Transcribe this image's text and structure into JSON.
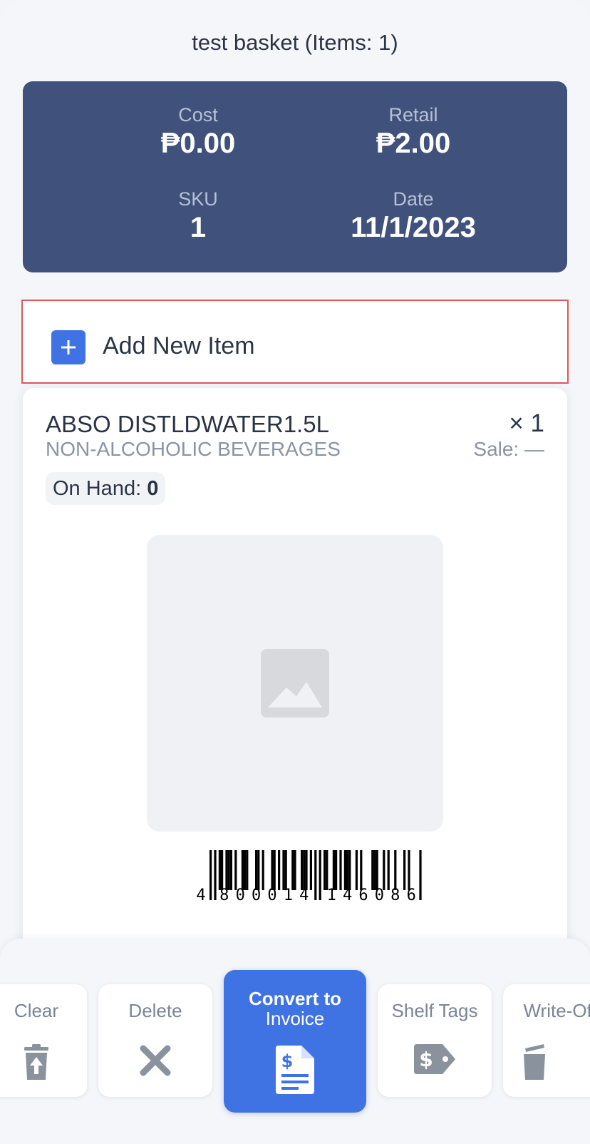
{
  "header": {
    "title": "test basket (Items: 1)"
  },
  "summary": {
    "cost_label": "Cost",
    "cost_value": "₱0.00",
    "retail_label": "Retail",
    "retail_value": "₱2.00",
    "sku_label": "SKU",
    "sku_value": "1",
    "date_label": "Date",
    "date_value": "11/1/2023"
  },
  "add_item": {
    "label": "Add New Item",
    "icon": "plus-icon"
  },
  "item": {
    "name": "ABSO DISTLDWATER1.5L",
    "category": "NON-ALCOHOLIC BEVERAGES",
    "quantity": "× 1",
    "sale": "Sale: —",
    "on_hand_label": "On Hand:",
    "on_hand_value": "0",
    "image_icon": "image-placeholder-icon",
    "barcode": "4800014146086"
  },
  "actions": {
    "clear": "Clear",
    "delete": "Delete",
    "convert_line1": "Convert to",
    "convert_line2": "Invoice",
    "shelf_tags": "Shelf Tags",
    "write_off": "Write-Off"
  },
  "colors": {
    "summary_bg": "#40527c",
    "accent": "#3f73e4",
    "highlight_border": "#e25757"
  }
}
